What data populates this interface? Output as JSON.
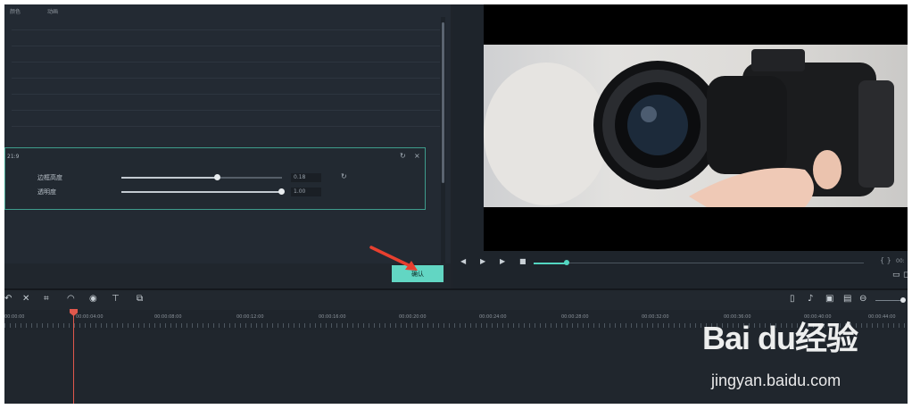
{
  "left_panel": {
    "tabs": [
      "颜色",
      "动画"
    ],
    "effect": {
      "title": "21:9",
      "reset_icon": "↻",
      "close_icon": "×",
      "params": [
        {
          "label": "边框高度",
          "value_text": "0.18",
          "fraction": 0.6
        },
        {
          "label": "透明度",
          "value_text": "1.00",
          "fraction": 1.0
        }
      ]
    },
    "ok_label": "确认"
  },
  "player": {
    "prev_icon": "◀",
    "play_icon": "▶",
    "next_icon": "▶",
    "stop_icon": "■",
    "progress_fraction": 0.1,
    "brackets": "{ }",
    "timecode": "00:"
  },
  "timeline": {
    "ruler_labels": [
      "00:00:00",
      "00:00:04:00",
      "00:00:08:00",
      "00:00:12:00",
      "00:00:16:00",
      "00:00:20:00",
      "00:00:24:00",
      "00:00:28:00",
      "00:00:32:00",
      "00:00:36:00",
      "00:00:40:00",
      "00:00:44:00"
    ]
  },
  "watermark": {
    "brand": "Bai du经验",
    "url": "jingyan.baidu.com"
  },
  "colors": {
    "accent": "#53d6c1",
    "ok_button": "#62d6c3",
    "playhead": "#e0584c",
    "annotation_arrow": "#e8402f"
  }
}
